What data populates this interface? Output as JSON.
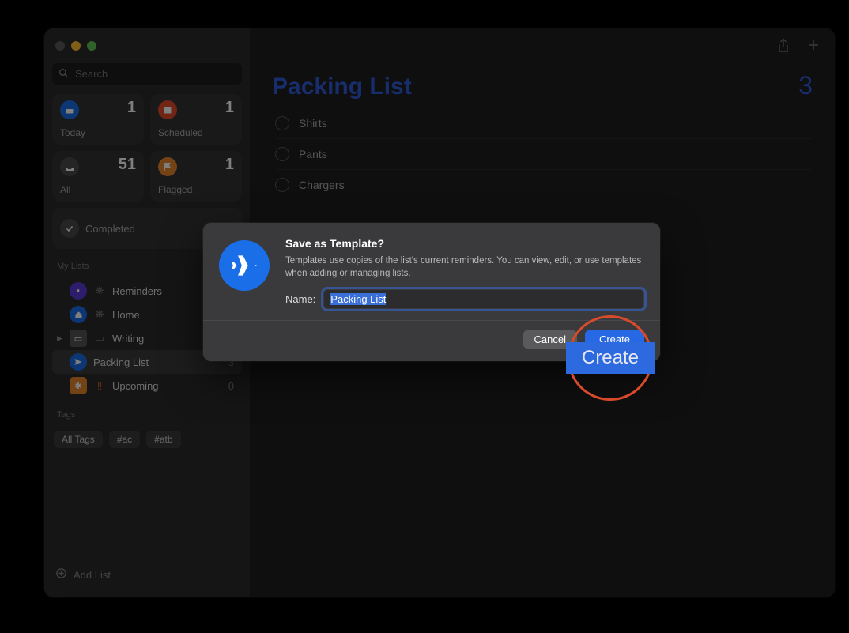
{
  "sidebar": {
    "search_placeholder": "Search",
    "smart": {
      "today": {
        "label": "Today",
        "count": "1"
      },
      "scheduled": {
        "label": "Scheduled",
        "count": "1"
      },
      "all": {
        "label": "All",
        "count": "51"
      },
      "flagged": {
        "label": "Flagged",
        "count": "1"
      },
      "completed": {
        "label": "Completed"
      }
    },
    "my_lists_header": "My Lists",
    "lists": [
      {
        "name": "Reminders",
        "count": ""
      },
      {
        "name": "Home",
        "count": ""
      },
      {
        "name": "Writing",
        "count": ""
      },
      {
        "name": "Packing List",
        "count": "3"
      },
      {
        "name": "Upcoming",
        "count": "0"
      }
    ],
    "tags_header": "Tags",
    "tags": [
      "All Tags",
      "#ac",
      "#atb"
    ],
    "add_list": "Add List"
  },
  "main": {
    "title": "Packing List",
    "count": "3",
    "items": [
      "Shirts",
      "Pants",
      "Chargers"
    ]
  },
  "modal": {
    "title": "Save as Template?",
    "description": "Templates use copies of the list's current reminders. You can view, edit, or use templates when adding or managing lists.",
    "name_label": "Name:",
    "name_value": "Packing List",
    "cancel": "Cancel",
    "create": "Create"
  },
  "highlight": {
    "label": "Create"
  }
}
